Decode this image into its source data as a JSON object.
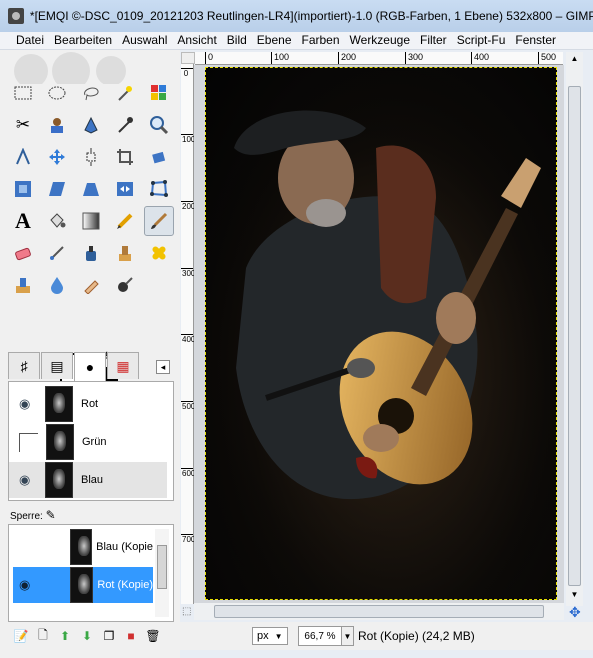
{
  "window": {
    "title": "*[EMQI ©-DSC_0109_20121203 Reutlingen-LR4](importiert)-1.0 (RGB-Farben, 1 Ebene) 532x800 – GIMP"
  },
  "menu": {
    "items": [
      "Datei",
      "Bearbeiten",
      "Auswahl",
      "Ansicht",
      "Bild",
      "Ebene",
      "Farben",
      "Werkzeuge",
      "Filter",
      "Script-Fu",
      "Fenster"
    ]
  },
  "toolbox": {
    "tools": [
      "rect-select",
      "ellipse-select",
      "free-select",
      "fuzzy-select",
      "select-by-color",
      "scissors-select",
      "foreground-select",
      "paths",
      "color-picker",
      "zoom",
      "measure",
      "move",
      "align",
      "crop",
      "rotate",
      "scale",
      "shear",
      "perspective",
      "flip",
      "cage-transform",
      "text",
      "bucket-fill",
      "blend",
      "pencil",
      "paintbrush",
      "eraser",
      "airbrush",
      "ink",
      "clone",
      "heal",
      "perspective-clone",
      "blur-sharpen",
      "smudge",
      "dodge-burn"
    ],
    "active_tool": "paintbrush"
  },
  "channels": {
    "rows": [
      {
        "name": "Rot",
        "visible": true
      },
      {
        "name": "Grün",
        "visible": false
      },
      {
        "name": "Blau",
        "visible": true
      }
    ]
  },
  "lock": {
    "label": "Sperre:"
  },
  "layers": {
    "rows": [
      {
        "name": "Blau (Kopie",
        "visible": false
      },
      {
        "name": "Rot (Kopie)",
        "visible": true,
        "selected": true
      }
    ]
  },
  "ruler": {
    "h_labels": [
      "0",
      "100",
      "200",
      "300",
      "400",
      "500"
    ],
    "v_labels": [
      "0",
      "100",
      "200",
      "300",
      "400",
      "500",
      "600",
      "700"
    ]
  },
  "statusbar": {
    "unit": "px",
    "zoom": "66,7 %",
    "text": "Rot (Kopie) (24,2 MB)"
  }
}
